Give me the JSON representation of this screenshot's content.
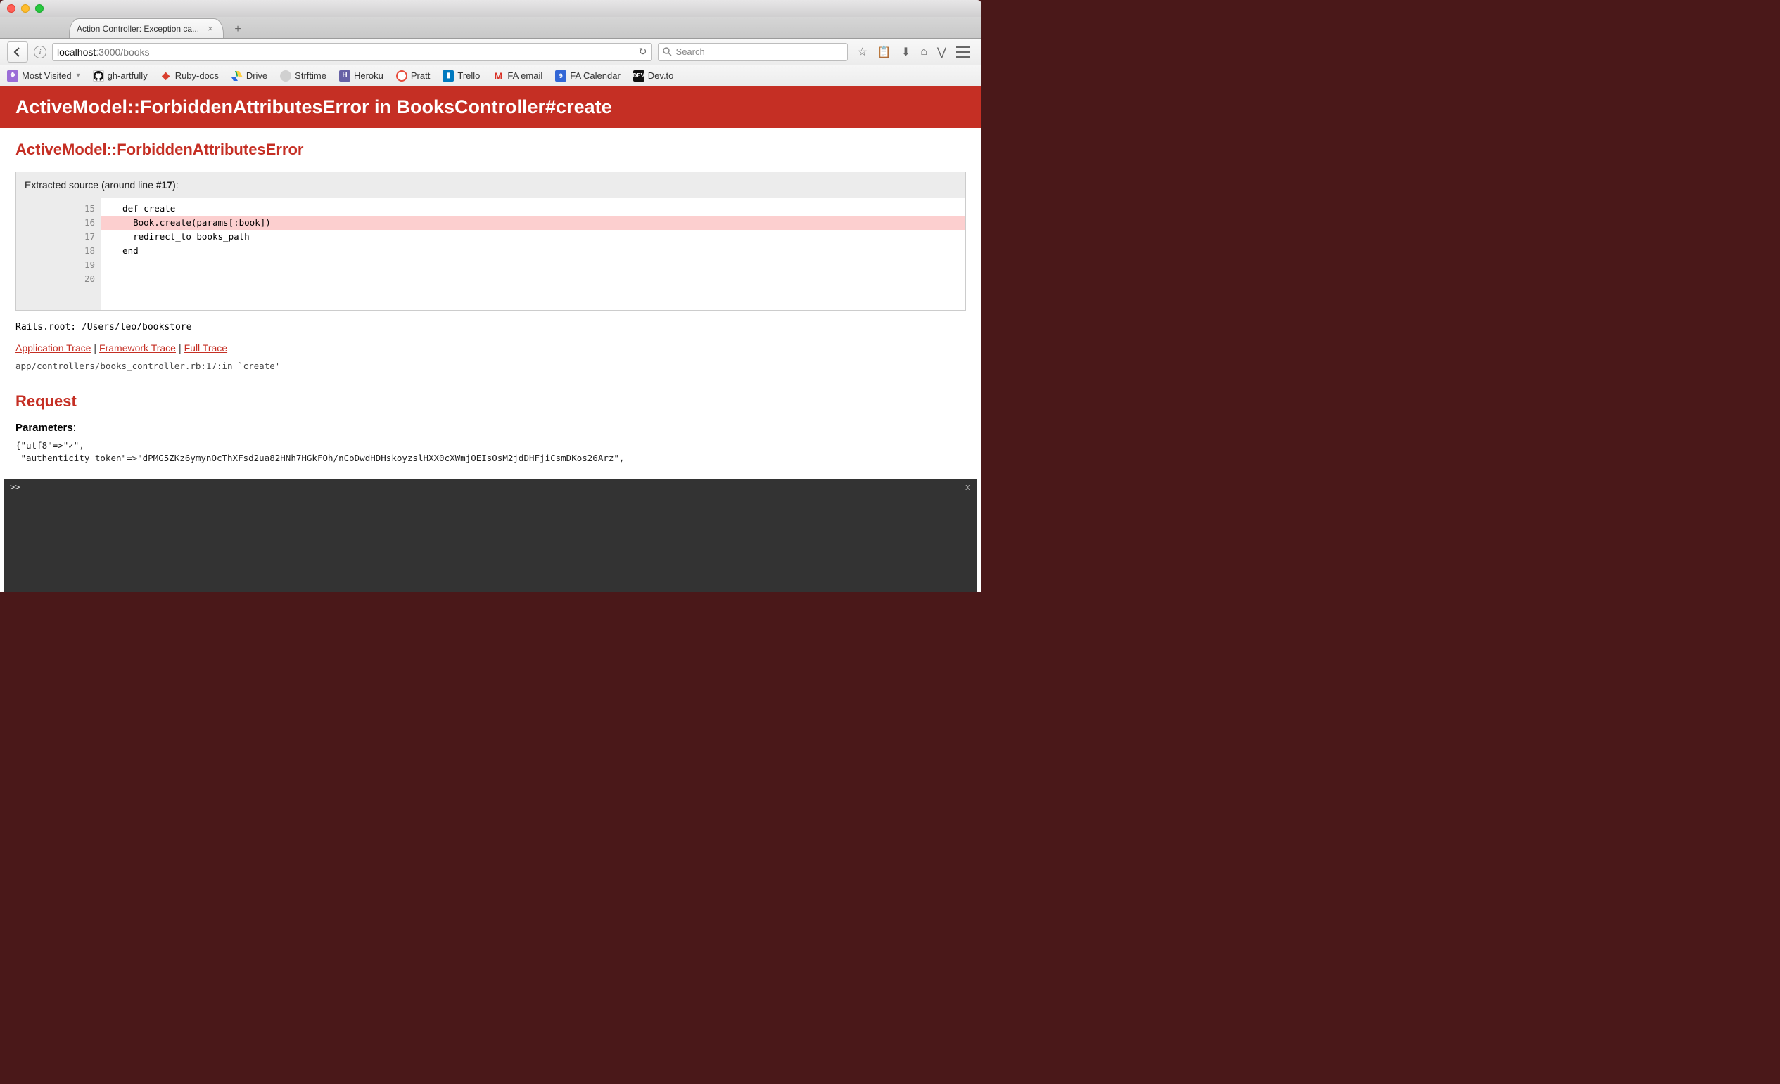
{
  "browser": {
    "tab_title": "Action Controller: Exception ca...",
    "url_host": "localhost",
    "url_port_path": ":3000/books",
    "search_placeholder": "Search",
    "bookmarks": [
      {
        "label": "Most Visited",
        "icon": "purple",
        "caret": true
      },
      {
        "label": "gh-artfully",
        "icon": "ghub"
      },
      {
        "label": "Ruby-docs",
        "icon": "ruby"
      },
      {
        "label": "Drive",
        "icon": "drive"
      },
      {
        "label": "Strftime",
        "icon": "globe"
      },
      {
        "label": "Heroku",
        "icon": "heroku"
      },
      {
        "label": "Pratt",
        "icon": "circle"
      },
      {
        "label": "Trello",
        "icon": "trello"
      },
      {
        "label": "FA email",
        "icon": "gmail"
      },
      {
        "label": "FA Calendar",
        "icon": "cal"
      },
      {
        "label": "Dev.to",
        "icon": "dev"
      }
    ]
  },
  "error": {
    "header": "ActiveModel::ForbiddenAttributesError in BooksController#create",
    "name": "ActiveModel::ForbiddenAttributesError",
    "source_label_prefix": "Extracted source (around line ",
    "source_line_no": "#17",
    "source_label_suffix": "):",
    "lines": [
      {
        "no": "15",
        "text": ""
      },
      {
        "no": "16",
        "text": "  def create"
      },
      {
        "no": "17",
        "text": "    Book.create(params[:book])",
        "hl": true
      },
      {
        "no": "18",
        "text": "    redirect_to books_path"
      },
      {
        "no": "19",
        "text": "  end"
      },
      {
        "no": "20",
        "text": ""
      }
    ],
    "rails_root": "Rails.root: /Users/leo/bookstore",
    "trace_links": {
      "app": "Application Trace",
      "fw": "Framework Trace",
      "full": "Full Trace"
    },
    "trace_line": "app/controllers/books_controller.rb:17:in `create'",
    "request_heading": "Request",
    "params_label": "Parameters",
    "params_dump": "{\"utf8\"=>\"✓\",\n \"authenticity_token\"=>\"dPMG5ZKz6ymynOcThXFsd2ua82HNh7HGkFOh/nCoDwdHDHskoyzslHXX0cXWmjOEIsOsM2jdDHFjiCsmDKos26Arz\","
  },
  "console": {
    "prompt": ">>",
    "close": "x"
  }
}
